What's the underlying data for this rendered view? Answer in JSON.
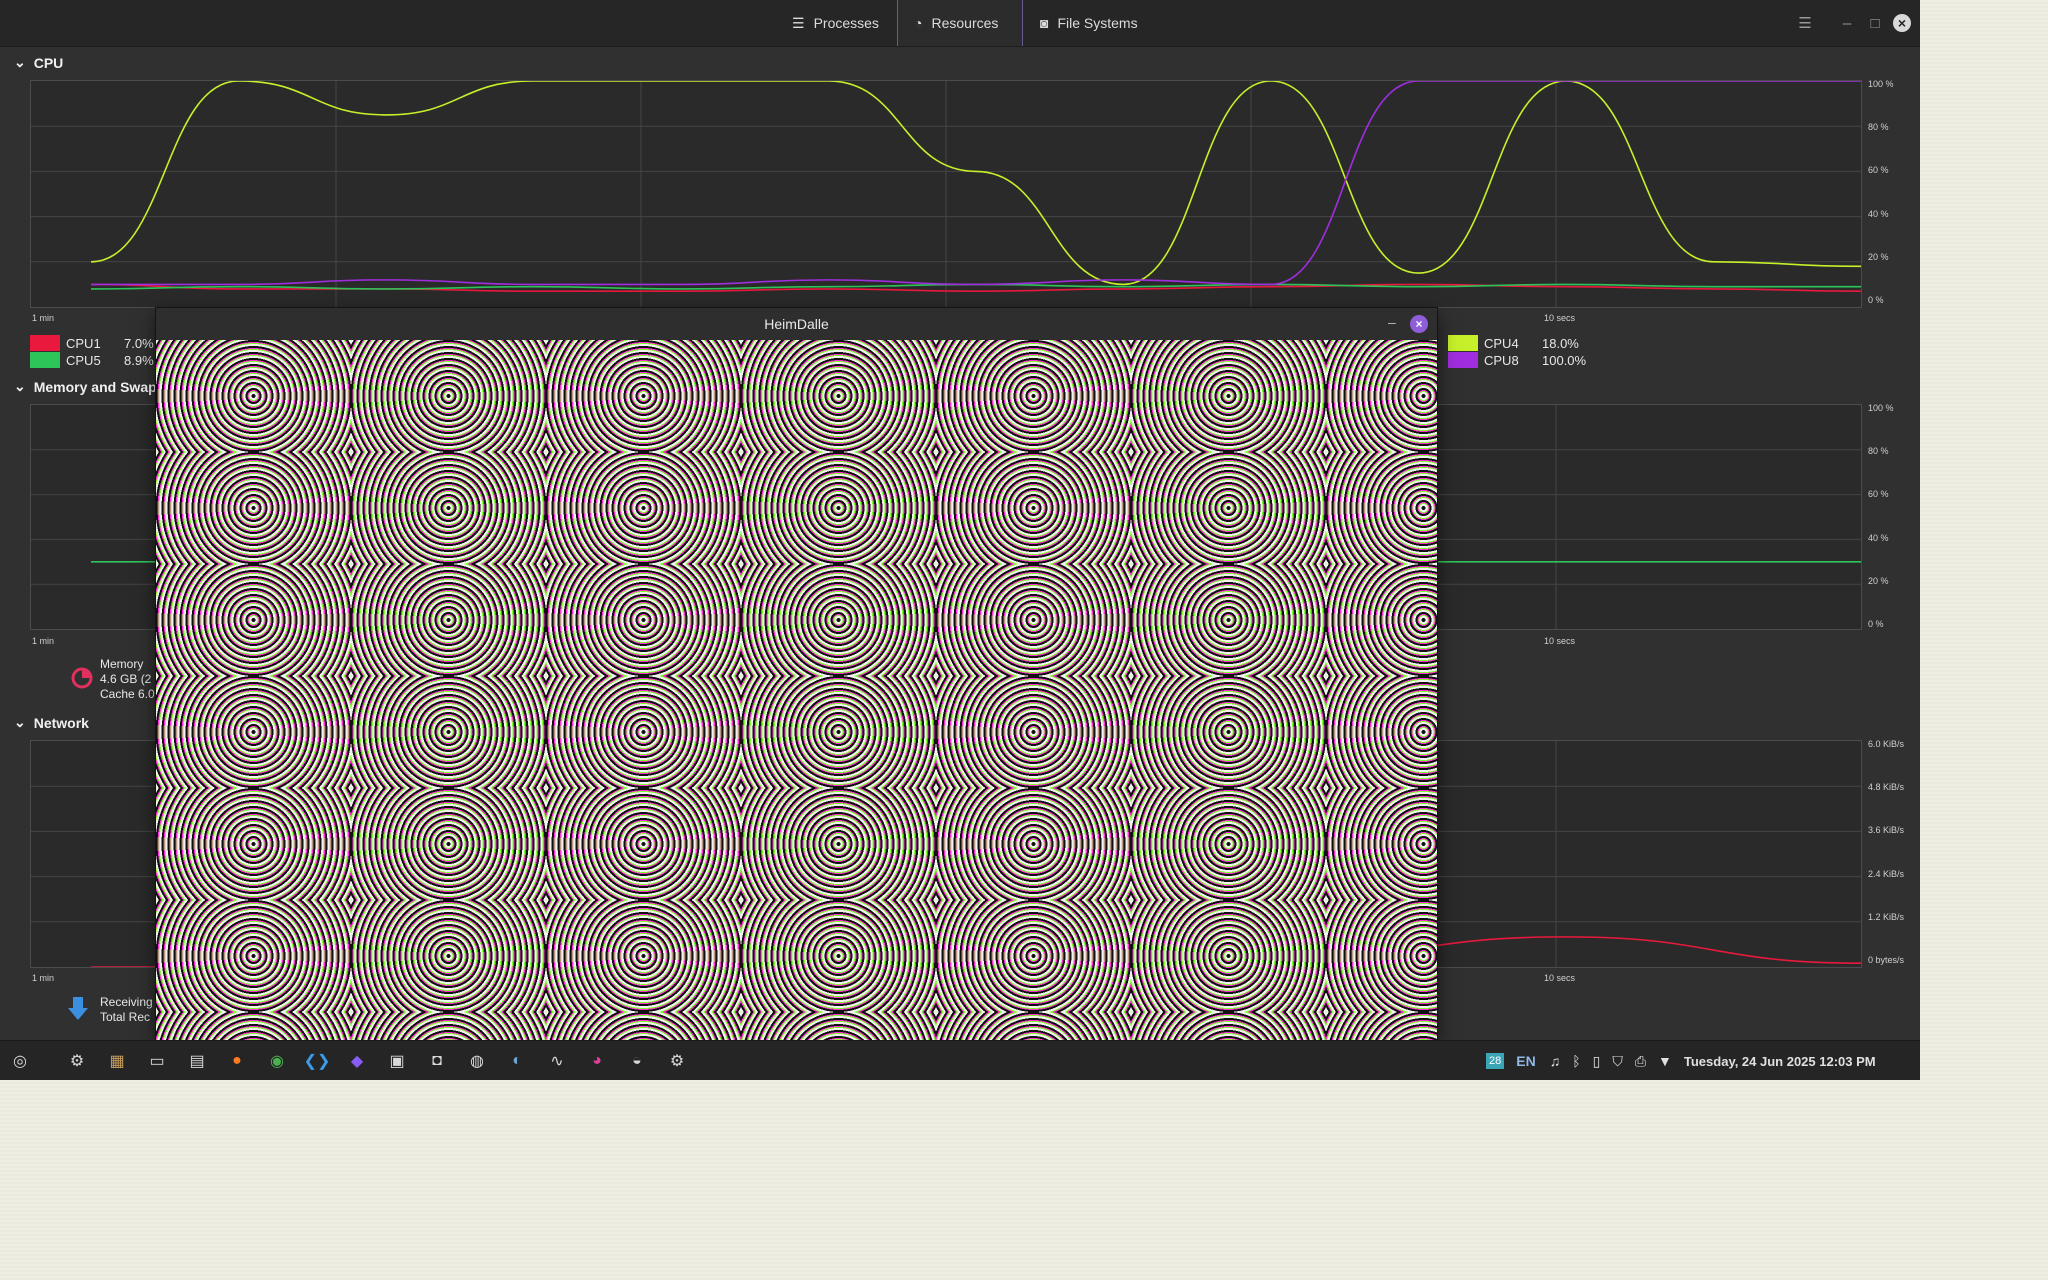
{
  "tabs": [
    {
      "label": "Processes",
      "icon": "list-icon"
    },
    {
      "label": "Resources",
      "icon": "gauge-icon"
    },
    {
      "label": "File Systems",
      "icon": "disk-icon"
    }
  ],
  "sections": {
    "cpu": "CPU",
    "memory": "Memory and Swap",
    "network": "Network"
  },
  "cpu_graph": {
    "y_ticks": [
      "100 %",
      "80 %",
      "60 %",
      "40 %",
      "20 %",
      "0 %"
    ],
    "x_labels": {
      "left": "1 min",
      "mid": "10 secs"
    },
    "legend": [
      {
        "name": "CPU1",
        "value": "7.0%",
        "color": "#e8193c"
      },
      {
        "name": "CPU5",
        "value": "8.9%",
        "color": "#2dc55a"
      },
      {
        "name": "CPU4",
        "value": "18.0%",
        "color": "#c6f02a"
      },
      {
        "name": "CPU8",
        "value": "100.0%",
        "color": "#a02de0"
      }
    ]
  },
  "memory_graph": {
    "y_ticks": [
      "100 %",
      "80 %",
      "60 %",
      "40 %",
      "20 %",
      "0 %"
    ],
    "x_labels": {
      "left": "1 min",
      "mid": "10 secs"
    },
    "legend_lines": [
      "Memory",
      "4.6 GB (2",
      "Cache 6.0"
    ]
  },
  "network_graph": {
    "y_ticks": [
      "6.0 KiB/s",
      "4.8 KiB/s",
      "3.6 KiB/s",
      "2.4 KiB/s",
      "1.2 KiB/s",
      "0 bytes/s"
    ],
    "x_labels": {
      "left": "1 min",
      "mid": "10 secs"
    },
    "legend_lines": [
      "Receiving",
      "Total Rec"
    ]
  },
  "overlay_window": {
    "title": "HeimDalle"
  },
  "taskbar": {
    "apps": [
      "mint-menu-icon",
      "settings-icon",
      "archive-icon",
      "terminal-icon",
      "files-icon",
      "firefox-icon",
      "chrome-icon",
      "vscode-icon",
      "obsidian-icon",
      "twitch-icon",
      "screenshot-icon",
      "browser-icon",
      "steam-icon",
      "system-monitor-icon",
      "color-picker-icon",
      "wallpaper-icon",
      "gear-app-icon"
    ],
    "calendar_badge": "28",
    "keyboard_layout": "EN",
    "clock": "Tuesday, 24 Jun 2025 12:03 PM"
  },
  "chart_data": [
    {
      "type": "line",
      "title": "CPU",
      "xlabel": "",
      "ylabel": "",
      "x": [
        60,
        55,
        50,
        45,
        40,
        35,
        30,
        25,
        20,
        15,
        10,
        5,
        0
      ],
      "ylim": [
        0,
        100
      ],
      "series": [
        {
          "name": "CPU1",
          "values": [
            10,
            8,
            8,
            7,
            7,
            8,
            7,
            8,
            9,
            10,
            9,
            8,
            7
          ]
        },
        {
          "name": "CPU5",
          "values": [
            8,
            9,
            8,
            9,
            8,
            9,
            10,
            9,
            10,
            9,
            10,
            9,
            9
          ]
        },
        {
          "name": "CPU4",
          "values": [
            20,
            100,
            85,
            100,
            100,
            100,
            60,
            10,
            100,
            15,
            100,
            20,
            18
          ]
        },
        {
          "name": "CPU8",
          "values": [
            10,
            10,
            12,
            10,
            10,
            12,
            10,
            12,
            10,
            100,
            100,
            100,
            100
          ]
        }
      ]
    },
    {
      "type": "line",
      "title": "Memory and Swap",
      "xlabel": "",
      "ylabel": "",
      "ylim": [
        0,
        100
      ],
      "series": [
        {
          "name": "Memory",
          "values": [
            30,
            30,
            30,
            30,
            30,
            30,
            30
          ]
        }
      ]
    },
    {
      "type": "line",
      "title": "Network",
      "xlabel": "",
      "ylabel": "",
      "ylim": [
        0,
        6.0
      ],
      "series": [
        {
          "name": "Receiving",
          "values": [
            0,
            0,
            0,
            0,
            0.2,
            0.8,
            0.1
          ]
        }
      ]
    }
  ]
}
